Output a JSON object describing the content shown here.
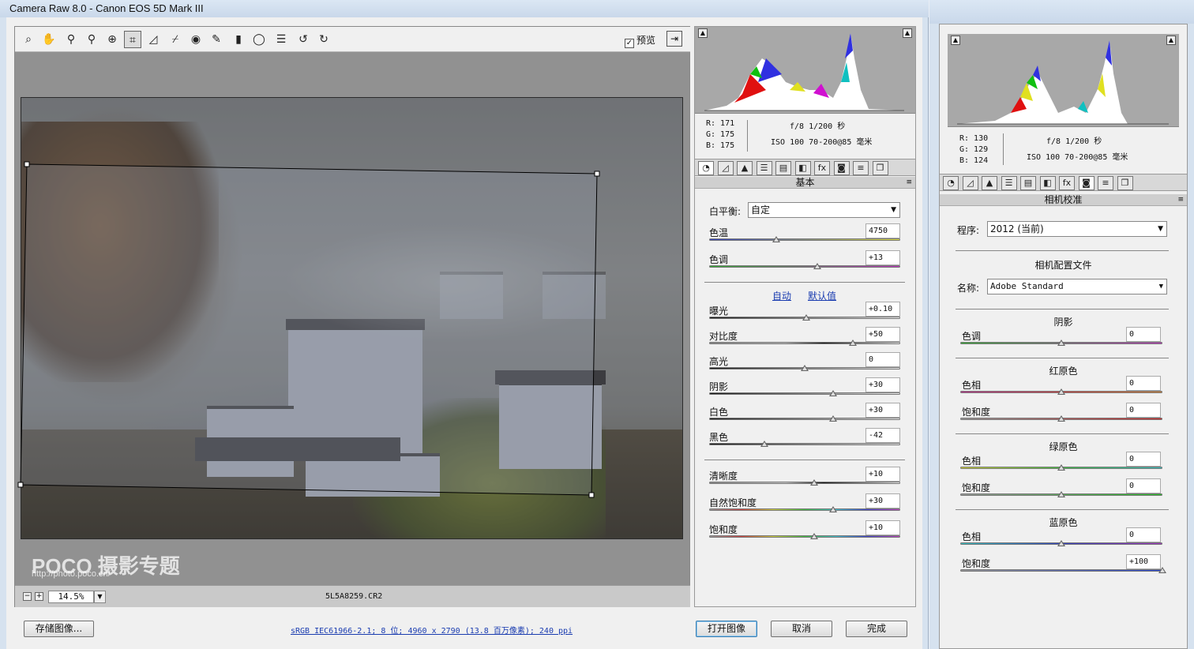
{
  "window": {
    "title": "Camera Raw 8.0 -  Canon EOS 5D Mark III"
  },
  "toolbar": {
    "tools": [
      "zoom-tool",
      "hand-tool",
      "white-balance-tool",
      "color-sampler-tool",
      "targeted-adjustment-tool",
      "crop-tool",
      "straighten-tool",
      "spot-removal-tool",
      "red-eye-tool",
      "adjustment-brush-tool",
      "graduated-filter-tool",
      "radial-filter-tool",
      "preferences-tool",
      "rotate-ccw-tool",
      "rotate-cw-tool"
    ],
    "glyphs": [
      "⌕",
      "✋",
      "⚲",
      "⚲",
      "⊕",
      "⌗",
      "◿",
      "⌿",
      "◉",
      "✎",
      "▮",
      "◯",
      "☰",
      "↺",
      "↻"
    ],
    "preview_label": "预览",
    "preview_checked": true
  },
  "canvas": {
    "watermark_logo": "POCO 摄影专题",
    "watermark_url": "http://photo.poco.cn/"
  },
  "zoom_bar": {
    "zoom": "14.5%",
    "filename": "5L5A8259.CR2"
  },
  "histogram_a": {
    "rgb": {
      "r": "R:  171",
      "g": "G:  175",
      "b": "B:  175"
    },
    "exif_line1": "f/8   1/200 秒",
    "exif_line2": "ISO 100   70-200@85 毫米"
  },
  "panel_a": {
    "section_title": "基本",
    "tab_glyphs": [
      "◔",
      "◿",
      "▲",
      "☰",
      "▤",
      "◧",
      "fx",
      "◙",
      "≡",
      "❐"
    ],
    "wb_label": "白平衡:",
    "wb_value": "自定",
    "auto_link": "自动",
    "default_link": "默认值",
    "sliders": [
      {
        "label": "色温",
        "value": "4750",
        "pos": 0.35,
        "bg": "linear-gradient(90deg,#3040c0,#e0e040)"
      },
      {
        "label": "色调",
        "value": "+13",
        "pos": 0.565,
        "bg": "linear-gradient(90deg,#30b030,#c030c0)"
      },
      {
        "label": "曝光",
        "value": "+0.10",
        "pos": 0.51,
        "bg": "linear-gradient(90deg,#111,#eee)"
      },
      {
        "label": "对比度",
        "value": "+50",
        "pos": 0.75,
        "bg": "linear-gradient(90deg,#888,#bbb 40%,#111 60%,#eee)"
      },
      {
        "label": "高光",
        "value": "0",
        "pos": 0.5,
        "bg": "linear-gradient(90deg,#111,#eee)"
      },
      {
        "label": "阴影",
        "value": "+30",
        "pos": 0.65,
        "bg": "linear-gradient(90deg,#111,#eee)"
      },
      {
        "label": "白色",
        "value": "+30",
        "pos": 0.65,
        "bg": "linear-gradient(90deg,#111,#eee)"
      },
      {
        "label": "黑色",
        "value": "-42",
        "pos": 0.29,
        "bg": "linear-gradient(90deg,#111,#eee)"
      },
      {
        "label": "清晰度",
        "value": "+10",
        "pos": 0.55,
        "bg": "linear-gradient(90deg,#888,#ccc 40%,#111 60%,#eee)"
      },
      {
        "label": "自然饱和度",
        "value": "+30",
        "pos": 0.65,
        "bg": "linear-gradient(90deg,#999,#d04040,#d0d040,#40c040,#40c0d0,#4040d0,#c040c0)"
      },
      {
        "label": "饱和度",
        "value": "+10",
        "pos": 0.55,
        "bg": "linear-gradient(90deg,#999,#d04040,#d0d040,#40c040,#40c0d0,#4040d0,#c040c0)"
      }
    ]
  },
  "footer": {
    "save_label": "存储图像...",
    "workflow_link": "sRGB IEC61966-2.1; 8 位; 4960 x 2790 (13.8 百万像素); 240 ppi",
    "open_label": "打开图像",
    "cancel_label": "取消",
    "done_label": "完成"
  },
  "histogram_b": {
    "rgb": {
      "r": "R:  130",
      "g": "G:  129",
      "b": "B:  124"
    },
    "exif_line1": "f/8   1/200 秒",
    "exif_line2": "ISO 100   70-200@85 毫米"
  },
  "panel_b": {
    "section_title": "相机校准",
    "process_label": "程序:",
    "process_value": "2012 (当前)",
    "profile_heading": "相机配置文件",
    "name_label": "名称:",
    "name_value": "Adobe Standard",
    "groups": [
      {
        "title": "阴影",
        "sliders": [
          {
            "label": "色调",
            "value": "0",
            "pos": 0.5,
            "bg": "linear-gradient(90deg,#30b030,#c030c0)"
          }
        ]
      },
      {
        "title": "红原色",
        "sliders": [
          {
            "label": "色相",
            "value": "0",
            "pos": 0.5,
            "bg": "linear-gradient(90deg,#c03090,#d04040,#d08030)"
          },
          {
            "label": "饱和度",
            "value": "0",
            "pos": 0.5,
            "bg": "linear-gradient(90deg,#999,#d02020)"
          }
        ]
      },
      {
        "title": "绿原色",
        "sliders": [
          {
            "label": "色相",
            "value": "0",
            "pos": 0.5,
            "bg": "linear-gradient(90deg,#d0d030,#40c040,#30c0c0)"
          },
          {
            "label": "饱和度",
            "value": "0",
            "pos": 0.5,
            "bg": "linear-gradient(90deg,#999,#20c020)"
          }
        ]
      },
      {
        "title": "蓝原色",
        "sliders": [
          {
            "label": "色相",
            "value": "0",
            "pos": 0.5,
            "bg": "linear-gradient(90deg,#30c0c0,#3040c0,#a030c0)"
          },
          {
            "label": "饱和度",
            "value": "+100",
            "pos": 1.0,
            "bg": "linear-gradient(90deg,#999,#2040d0)"
          }
        ]
      }
    ]
  }
}
